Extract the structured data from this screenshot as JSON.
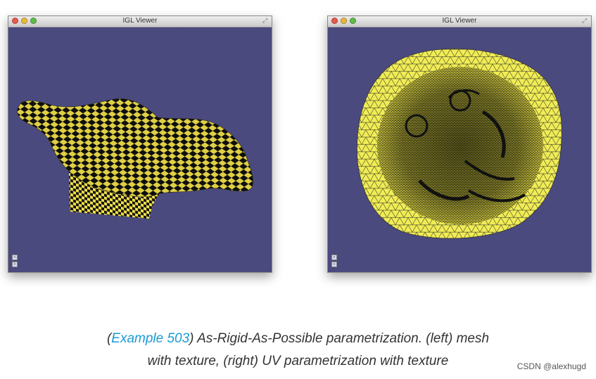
{
  "windows": [
    {
      "title": "IGL Viewer",
      "content": "textured-mesh"
    },
    {
      "title": "IGL Viewer",
      "content": "uv-parametrization"
    }
  ],
  "caption": {
    "open_paren": "(",
    "link_text": "Example 503",
    "line1_rest": ") As-Rigid-As-Possible parametrization. (left) mesh",
    "line2": "with texture, (right) UV parametrization with texture"
  },
  "watermark": "CSDN @alexhugd",
  "colors": {
    "viewport_bg": "#4a4a7e",
    "checker_yellow": "#f2e14a",
    "checker_black": "#111111",
    "uv_fill": "#f0ec55",
    "link": "#1a9bd7"
  },
  "icons": [
    "close-icon",
    "minimize-icon",
    "zoom-icon",
    "resize-icon"
  ]
}
